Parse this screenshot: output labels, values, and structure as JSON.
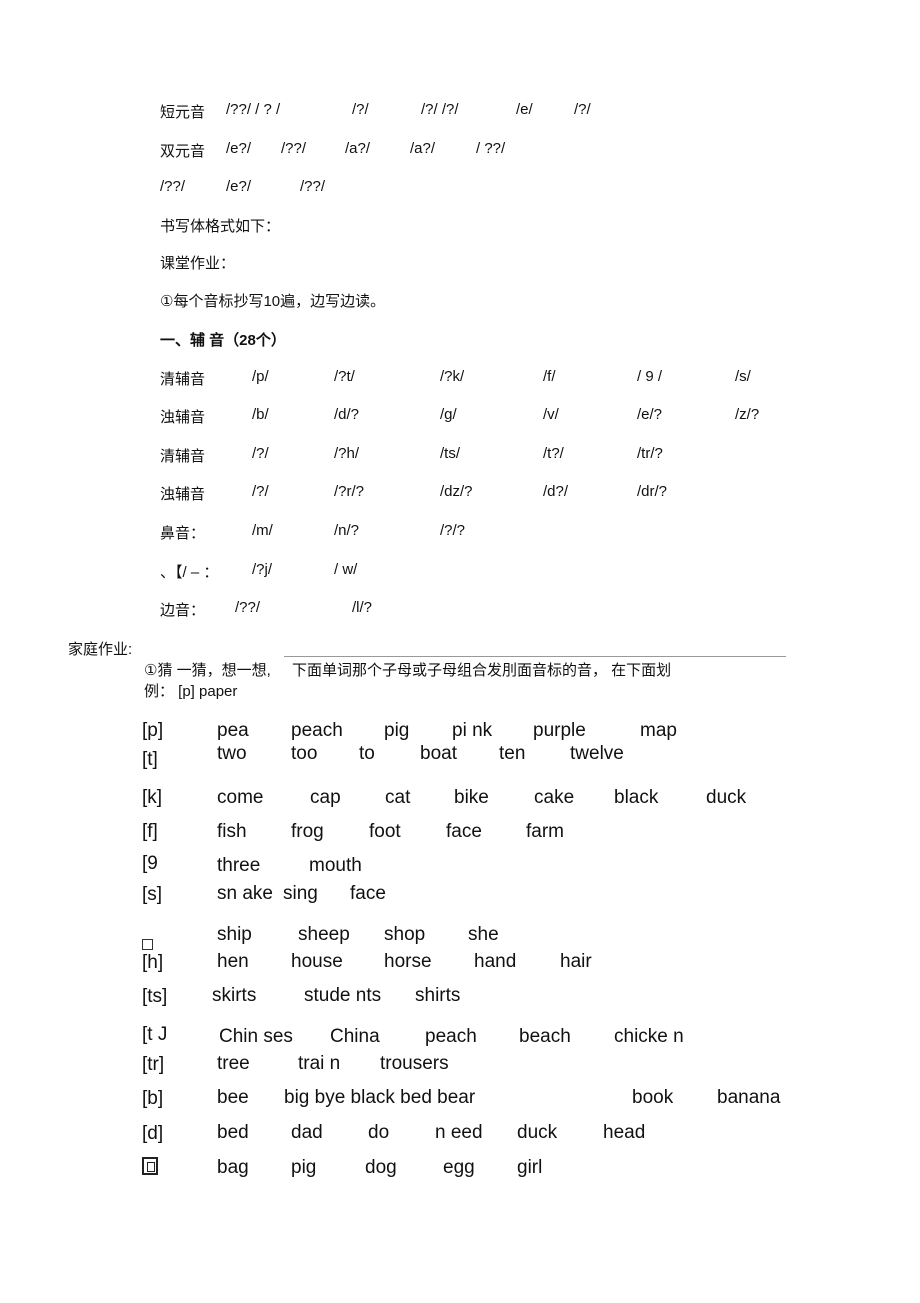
{
  "vowels": {
    "short": {
      "label": "短元音",
      "items": [
        "/??/ / ? /",
        "/?/",
        "/?/ /?/",
        "/e/",
        "/?/"
      ]
    },
    "diphthong": {
      "label": "双元音",
      "items": [
        "/e?/",
        "/??/",
        "/a?/",
        "/a?/",
        "/ ??/"
      ]
    },
    "diphthong_cont": {
      "items": [
        "/??/",
        "/e?/",
        "/??/"
      ]
    }
  },
  "notes": {
    "format": "书写体格式如下：",
    "classwork": "课堂作业：",
    "task1": "①每个音标抄写10遍，边写边读。",
    "section": "一、辅  音（28个）"
  },
  "consonants": [
    {
      "label": "清辅音",
      "items": [
        "/p/",
        "/?t/",
        "/?k/",
        "/f/",
        "/ 9 /",
        "/s/"
      ]
    },
    {
      "label": "浊辅音",
      "items": [
        "/b/",
        "/d/?",
        "/g/",
        "/v/",
        "/e/?",
        "/z/?"
      ]
    },
    {
      "label": "清辅音",
      "items": [
        "/?/",
        "/?h/",
        "/ts/",
        "/t?/",
        "/tr/?"
      ]
    },
    {
      "label": "浊辅音",
      "items": [
        "/?/",
        "/?r/?",
        "/dz/?",
        "/d?/",
        "/dr/?"
      ]
    },
    {
      "label": "鼻音：",
      "items": [
        "/m/",
        "/n/?",
        "/?/?"
      ]
    },
    {
      "label": "、【/ – ：",
      "items": [
        "/?j/",
        "/ w/"
      ]
    },
    {
      "label": "边音：",
      "items": [
        "/??/",
        "/l/?"
      ]
    }
  ],
  "homework": {
    "title": "家庭作业:",
    "instruction_a": "①猜 一猜，想一想,",
    "instruction_b": "下面单词那个子母或子母组合发刖面音标的音，  在下面划",
    "example": "例：  [p] paper"
  },
  "word_rows": [
    {
      "symbol": "[p]",
      "words": [
        "pea",
        "peach",
        "pig",
        "pi nk",
        "purple",
        "map"
      ]
    },
    {
      "symbol": "[t]",
      "words": [
        "two",
        "too",
        "to",
        "boat",
        "ten",
        "twelve"
      ]
    },
    {
      "symbol": "[k]",
      "words": [
        "come",
        "cap",
        "cat",
        "bike",
        "cake",
        "black",
        "duck"
      ]
    },
    {
      "symbol": "[f]",
      "words": [
        "fish",
        "frog",
        "foot",
        "face",
        "farm"
      ]
    },
    {
      "symbol": "[9",
      "words": [
        "three",
        "mouth"
      ]
    },
    {
      "symbol": "[s]",
      "words": [
        "sn ake",
        "sing",
        "face"
      ]
    },
    {
      "symbol": "□",
      "words": [
        "ship",
        "sheep",
        "shop",
        "she"
      ]
    },
    {
      "symbol": "[h]",
      "words": [
        "hen",
        "house",
        "horse",
        "hand",
        "hair"
      ]
    },
    {
      "symbol": "[ts]",
      "words": [
        "skirts",
        "stude nts",
        "shirts"
      ]
    },
    {
      "symbol": "[t J",
      "words": [
        "Chin ses",
        "China",
        "peach",
        "beach",
        "chicke n"
      ]
    },
    {
      "symbol": "[tr]",
      "words": [
        "tree",
        "trai n",
        "trousers"
      ]
    },
    {
      "symbol": "[b]",
      "words": [
        "bee",
        "big bye black bed bear",
        "book",
        "banana"
      ]
    },
    {
      "symbol": "[d]",
      "words": [
        "bed",
        "dad",
        "do",
        "n eed",
        "duck",
        "head"
      ]
    },
    {
      "symbol": "回",
      "words": [
        "bag",
        "pig",
        "dog",
        "egg",
        "girl"
      ]
    }
  ]
}
